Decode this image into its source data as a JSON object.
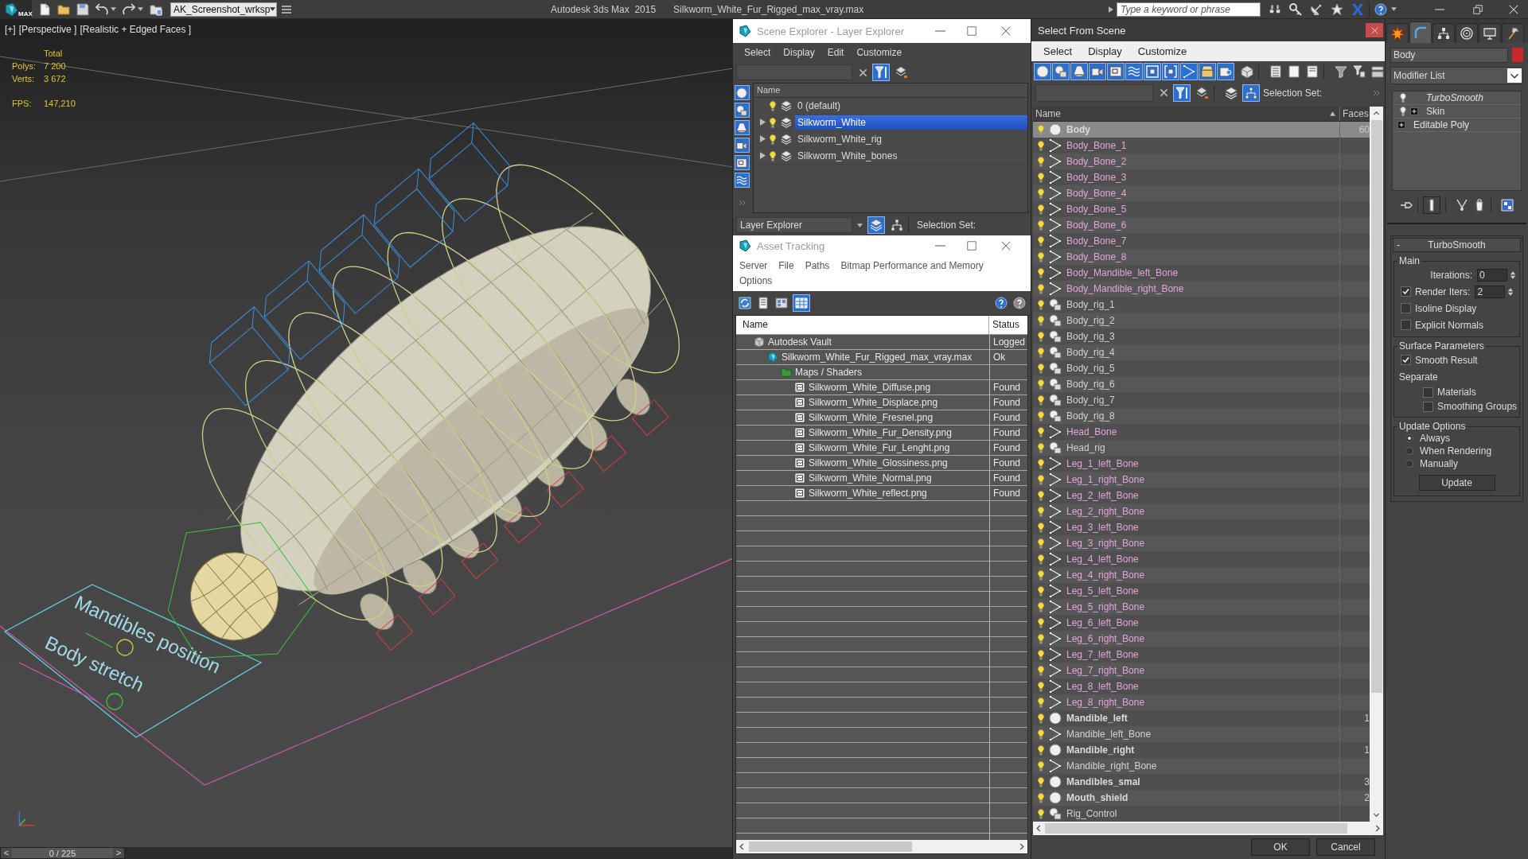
{
  "app_bar": {
    "logo_text": "MAX",
    "workspace": "AK_Screenshot_wrksp",
    "title": "Autodesk 3ds Max  2015",
    "file_name": "Silkworm_White_Fur_Rigged_max_vray.max",
    "search": {
      "placeholder": "Type a keyword or phrase"
    }
  },
  "viewport": {
    "labels": [
      "[+]",
      "[Perspective ]",
      "[Realistic + Edged Faces ]"
    ],
    "stats": {
      "heading": "Total",
      "rows": [
        {
          "label": "Polys:",
          "value": "7 200"
        },
        {
          "label": "Verts:",
          "value": "3 672"
        }
      ],
      "fps": {
        "label": "FPS:",
        "value": "147,210"
      }
    },
    "scene_texts": [
      "Mandibles position",
      "Body stretch"
    ]
  },
  "time_slider": {
    "prev": "<",
    "frame": "0 / 225",
    "next": ">",
    "level": 0
  },
  "scene_explorer": {
    "title": "Scene Explorer - Layer Explorer",
    "menu": [
      "Select",
      "Display",
      "Edit",
      "Customize"
    ],
    "column": "Name",
    "layers": [
      {
        "name": "0 (default)",
        "expandable": false,
        "selected": false
      },
      {
        "name": "Silkworm_White",
        "expandable": true,
        "selected": true
      },
      {
        "name": "Silkworm_White_rig",
        "expandable": true,
        "selected": false
      },
      {
        "name": "Silkworm_White_bones",
        "expandable": true,
        "selected": false
      }
    ],
    "explorer_type": "Layer Explorer",
    "selection_set_label": "Selection Set:"
  },
  "asset_tracking": {
    "title": "Asset Tracking",
    "menu": [
      "Server",
      "File",
      "Paths",
      "Bitmap Performance and Memory",
      "Options"
    ],
    "columns": [
      "Name",
      "Status"
    ],
    "rows": [
      {
        "kind": "vault",
        "name": "Autodesk Vault",
        "status": "Logged",
        "children": [
          {
            "kind": "scene",
            "name": "Silkworm_White_Fur_Rigged_max_vray.max",
            "status": "Ok",
            "children": [
              {
                "kind": "folder",
                "name": "Maps / Shaders",
                "children": [
                  {
                    "kind": "bitmap",
                    "name": "Silkworm_White_Diffuse.png",
                    "status": "Found"
                  },
                  {
                    "kind": "bitmap",
                    "name": "Silkworm_White_Displace.png",
                    "status": "Found"
                  },
                  {
                    "kind": "bitmap",
                    "name": "Silkworm_White_Fresnel.png",
                    "status": "Found"
                  },
                  {
                    "kind": "bitmap",
                    "name": "Silkworm_White_Fur_Density.png",
                    "status": "Found"
                  },
                  {
                    "kind": "bitmap",
                    "name": "Silkworm_White_Fur_Lenght.png",
                    "status": "Found"
                  },
                  {
                    "kind": "bitmap",
                    "name": "Silkworm_White_Glossiness.png",
                    "status": "Found"
                  },
                  {
                    "kind": "bitmap",
                    "name": "Silkworm_White_Normal.png",
                    "status": "Found"
                  },
                  {
                    "kind": "bitmap",
                    "name": "Silkworm_White_reflect.png",
                    "status": "Found"
                  }
                ]
              }
            ]
          }
        ]
      }
    ]
  },
  "select_from_scene": {
    "title": "Select From Scene",
    "menu": [
      "Select",
      "Display",
      "Customize"
    ],
    "selection_set_label": "Selection Set:",
    "columns": [
      "Name",
      "Faces"
    ],
    "objects": [
      {
        "name": "Body",
        "kind": "mesh",
        "color": "#dadada",
        "faces": "60",
        "selected": true
      },
      {
        "name": "Body_Bone_1",
        "kind": "bone",
        "color": "#e2a4dc",
        "selected": false
      },
      {
        "name": "Body_Bone_2",
        "kind": "bone",
        "color": "#e2a4dc",
        "selected": false
      },
      {
        "name": "Body_Bone_3",
        "kind": "bone",
        "color": "#e2a4dc",
        "selected": false
      },
      {
        "name": "Body_Bone_4",
        "kind": "bone",
        "color": "#e2a4dc",
        "selected": false
      },
      {
        "name": "Body_Bone_5",
        "kind": "bone",
        "color": "#e2a4dc",
        "selected": false
      },
      {
        "name": "Body_Bone_6",
        "kind": "bone",
        "color": "#e2a4dc",
        "selected": false
      },
      {
        "name": "Body_Bone_7",
        "kind": "bone",
        "color": "#e2a4dc",
        "selected": false
      },
      {
        "name": "Body_Bone_8",
        "kind": "bone",
        "color": "#e2a4dc",
        "selected": false
      },
      {
        "name": "Body_Mandible_left_Bone",
        "kind": "bone",
        "color": "#e2a4dc",
        "selected": false
      },
      {
        "name": "Body_Mandible_right_Bone",
        "kind": "bone",
        "color": "#e2a4dc",
        "selected": false
      },
      {
        "name": "Body_rig_1",
        "kind": "shape",
        "color": "#d4cfd4",
        "selected": false
      },
      {
        "name": "Body_rig_2",
        "kind": "shape",
        "color": "#d4cfd4",
        "selected": false
      },
      {
        "name": "Body_rig_3",
        "kind": "shape",
        "color": "#d4cfd4",
        "selected": false
      },
      {
        "name": "Body_rig_4",
        "kind": "shape",
        "color": "#d4cfd4",
        "selected": false
      },
      {
        "name": "Body_rig_5",
        "kind": "shape",
        "color": "#d4cfd4",
        "selected": false
      },
      {
        "name": "Body_rig_6",
        "kind": "shape",
        "color": "#d4cfd4",
        "selected": false
      },
      {
        "name": "Body_rig_7",
        "kind": "shape",
        "color": "#d4cfd4",
        "selected": false
      },
      {
        "name": "Body_rig_8",
        "kind": "shape",
        "color": "#d4cfd4",
        "selected": false
      },
      {
        "name": "Head_Bone",
        "kind": "bone",
        "color": "#e2a4dc",
        "selected": false
      },
      {
        "name": "Head_rig",
        "kind": "shape",
        "color": "#d4cfd4",
        "selected": false
      },
      {
        "name": "Leg_1_left_Bone",
        "kind": "bone",
        "color": "#e2a4dc",
        "selected": false
      },
      {
        "name": "Leg_1_right_Bone",
        "kind": "bone",
        "color": "#e2a4dc",
        "selected": false
      },
      {
        "name": "Leg_2_left_Bone",
        "kind": "bone",
        "color": "#e2a4dc",
        "selected": false
      },
      {
        "name": "Leg_2_right_Bone",
        "kind": "bone",
        "color": "#e2a4dc",
        "selected": false
      },
      {
        "name": "Leg_3_left_Bone",
        "kind": "bone",
        "color": "#e2a4dc",
        "selected": false
      },
      {
        "name": "Leg_3_right_Bone",
        "kind": "bone",
        "color": "#e2a4dc",
        "selected": false
      },
      {
        "name": "Leg_4_left_Bone",
        "kind": "bone",
        "color": "#e2a4dc",
        "selected": false
      },
      {
        "name": "Leg_4_right_Bone",
        "kind": "bone",
        "color": "#e2a4dc",
        "selected": false
      },
      {
        "name": "Leg_5_left_Bone",
        "kind": "bone",
        "color": "#e2a4dc",
        "selected": false
      },
      {
        "name": "Leg_5_right_Bone",
        "kind": "bone",
        "color": "#e2a4dc",
        "selected": false
      },
      {
        "name": "Leg_6_left_Bone",
        "kind": "bone",
        "color": "#e2a4dc",
        "selected": false
      },
      {
        "name": "Leg_6_right_Bone",
        "kind": "bone",
        "color": "#e2a4dc",
        "selected": false
      },
      {
        "name": "Leg_7_left_Bone",
        "kind": "bone",
        "color": "#e2a4dc",
        "selected": false
      },
      {
        "name": "Leg_7_right_Bone",
        "kind": "bone",
        "color": "#e2a4dc",
        "selected": false
      },
      {
        "name": "Leg_8_left_Bone",
        "kind": "bone",
        "color": "#e2a4dc",
        "selected": false
      },
      {
        "name": "Leg_8_right_Bone",
        "kind": "bone",
        "color": "#e2a4dc",
        "selected": false
      },
      {
        "name": "Mandible_left",
        "kind": "mesh",
        "color": "#dadada",
        "faces": "1",
        "selected": false
      },
      {
        "name": "Mandible_left_Bone",
        "kind": "bone",
        "color": "#d4cfd4",
        "selected": false
      },
      {
        "name": "Mandible_right",
        "kind": "mesh",
        "color": "#dadada",
        "faces": "1",
        "selected": false
      },
      {
        "name": "Mandible_right_Bone",
        "kind": "bone",
        "color": "#d4cfd4",
        "selected": false
      },
      {
        "name": "Mandibles_smal",
        "kind": "mesh",
        "color": "#dadada",
        "faces": "3",
        "selected": false
      },
      {
        "name": "Mouth_shield",
        "kind": "mesh",
        "color": "#dadada",
        "faces": "2",
        "selected": false
      },
      {
        "name": "Rig_Control",
        "kind": "shape",
        "color": "#d4cfd4",
        "selected": false
      }
    ],
    "buttons": [
      "OK",
      "Cancel"
    ]
  },
  "command_panel": {
    "tabs": [
      {
        "kind": "create",
        "selected": false
      },
      {
        "kind": "modify",
        "selected": true
      },
      {
        "kind": "hierarchy",
        "selected": false
      },
      {
        "kind": "motion",
        "selected": false
      },
      {
        "kind": "display",
        "selected": false
      },
      {
        "kind": "utilities",
        "selected": false
      }
    ],
    "object_name": "Body",
    "modifier_list": "Modifier List",
    "stack": [
      {
        "name": "TurboSmooth",
        "kind": "modifier",
        "expandable": false,
        "off_in_viewport": true
      },
      {
        "name": "Skin",
        "kind": "modifier",
        "expandable": true,
        "off_in_viewport": false
      },
      {
        "name": "Editable Poly",
        "kind": "base",
        "expandable": true,
        "off_in_viewport": false
      }
    ],
    "rollout": {
      "title": "TurboSmooth",
      "collapse": "-",
      "groups": [
        {
          "title": "Main",
          "controls": [
            {
              "kind": "spinner",
              "label": "Iterations:",
              "value": "0"
            },
            {
              "kind": "check_spinner",
              "label": "Render Iters:",
              "checked": true,
              "value": "2"
            },
            {
              "kind": "checkbox",
              "label": "Isoline Display",
              "checked": false
            },
            {
              "kind": "checkbox",
              "label": "Explicit Normals",
              "checked": false
            }
          ]
        },
        {
          "title": "Surface Parameters",
          "controls": [
            {
              "kind": "checkbox",
              "label": "Smooth Result",
              "checked": true
            },
            {
              "kind": "heading",
              "label": "Separate",
              "children": [
                {
                  "kind": "checkbox",
                  "label": "Materials",
                  "checked": false
                },
                {
                  "kind": "checkbox",
                  "label": "Smoothing Groups",
                  "checked": false
                }
              ]
            }
          ]
        },
        {
          "title": "Update Options",
          "controls": [
            {
              "kind": "radio",
              "label": "Always",
              "selected": true
            },
            {
              "kind": "radio",
              "label": "When Rendering",
              "selected": false
            },
            {
              "kind": "radio",
              "label": "Manually",
              "selected": false
            },
            {
              "kind": "button",
              "label": "Update"
            }
          ]
        }
      ]
    }
  }
}
